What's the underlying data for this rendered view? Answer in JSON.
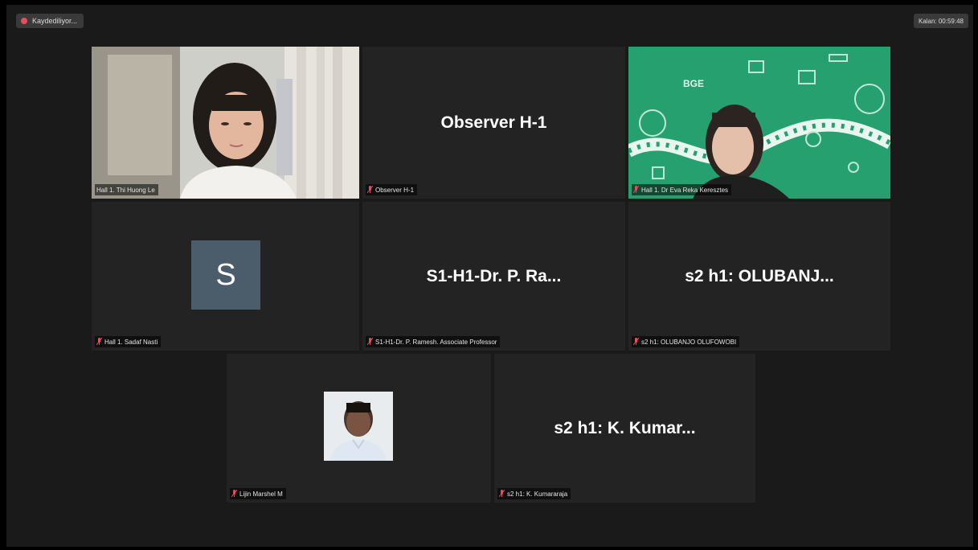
{
  "recording": {
    "label": "Kaydediliyor..."
  },
  "timer": {
    "label": "Kalan: 00:59:48"
  },
  "tiles": [
    {
      "label": "Hall 1. Thi Huong Le",
      "type": "video"
    },
    {
      "label": "Observer H-1",
      "display": "Observer H-1",
      "type": "name"
    },
    {
      "label": "Hall 1. Dr Eva Reka Keresztes",
      "type": "video",
      "bg_text": "BGE"
    },
    {
      "label": "Hall 1. Sadaf Nasti",
      "avatar_letter": "S",
      "type": "avatar"
    },
    {
      "label": "S1-H1-Dr. P. Ramesh. Associate Professor",
      "display": "S1-H1-Dr. P. Ra...",
      "type": "name"
    },
    {
      "label": "s2 h1: OLUBANJO OLUFOWOBI",
      "display": "s2 h1: OLUBANJ...",
      "type": "name"
    },
    {
      "label": "Lijin Marshel M",
      "type": "photo"
    },
    {
      "label": "s2 h1: K. Kumararaja",
      "display": "s2 h1: K. Kumar...",
      "type": "name"
    }
  ],
  "colors": {
    "active_speaker_border": "#d6e04a",
    "muted_mic": "#e84d5b",
    "green_bg": "#25a06e",
    "avatar_bg": "#4b5d6b"
  }
}
